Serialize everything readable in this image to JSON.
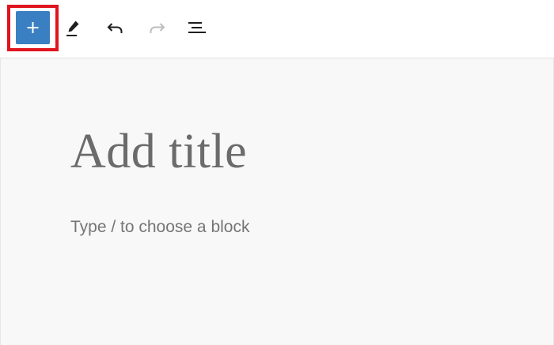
{
  "toolbar": {
    "inserter": {
      "icon": "plus-icon",
      "accent_color": "#3a7fc1",
      "highlight_color": "#e0141e"
    },
    "tools": [
      {
        "icon": "pencil-icon",
        "enabled": true
      },
      {
        "icon": "undo-icon",
        "enabled": true
      },
      {
        "icon": "redo-icon",
        "enabled": false
      },
      {
        "icon": "document-outline-icon",
        "enabled": true
      }
    ]
  },
  "editor": {
    "title_placeholder": "Add title",
    "block_placeholder": "Type / to choose a block"
  }
}
